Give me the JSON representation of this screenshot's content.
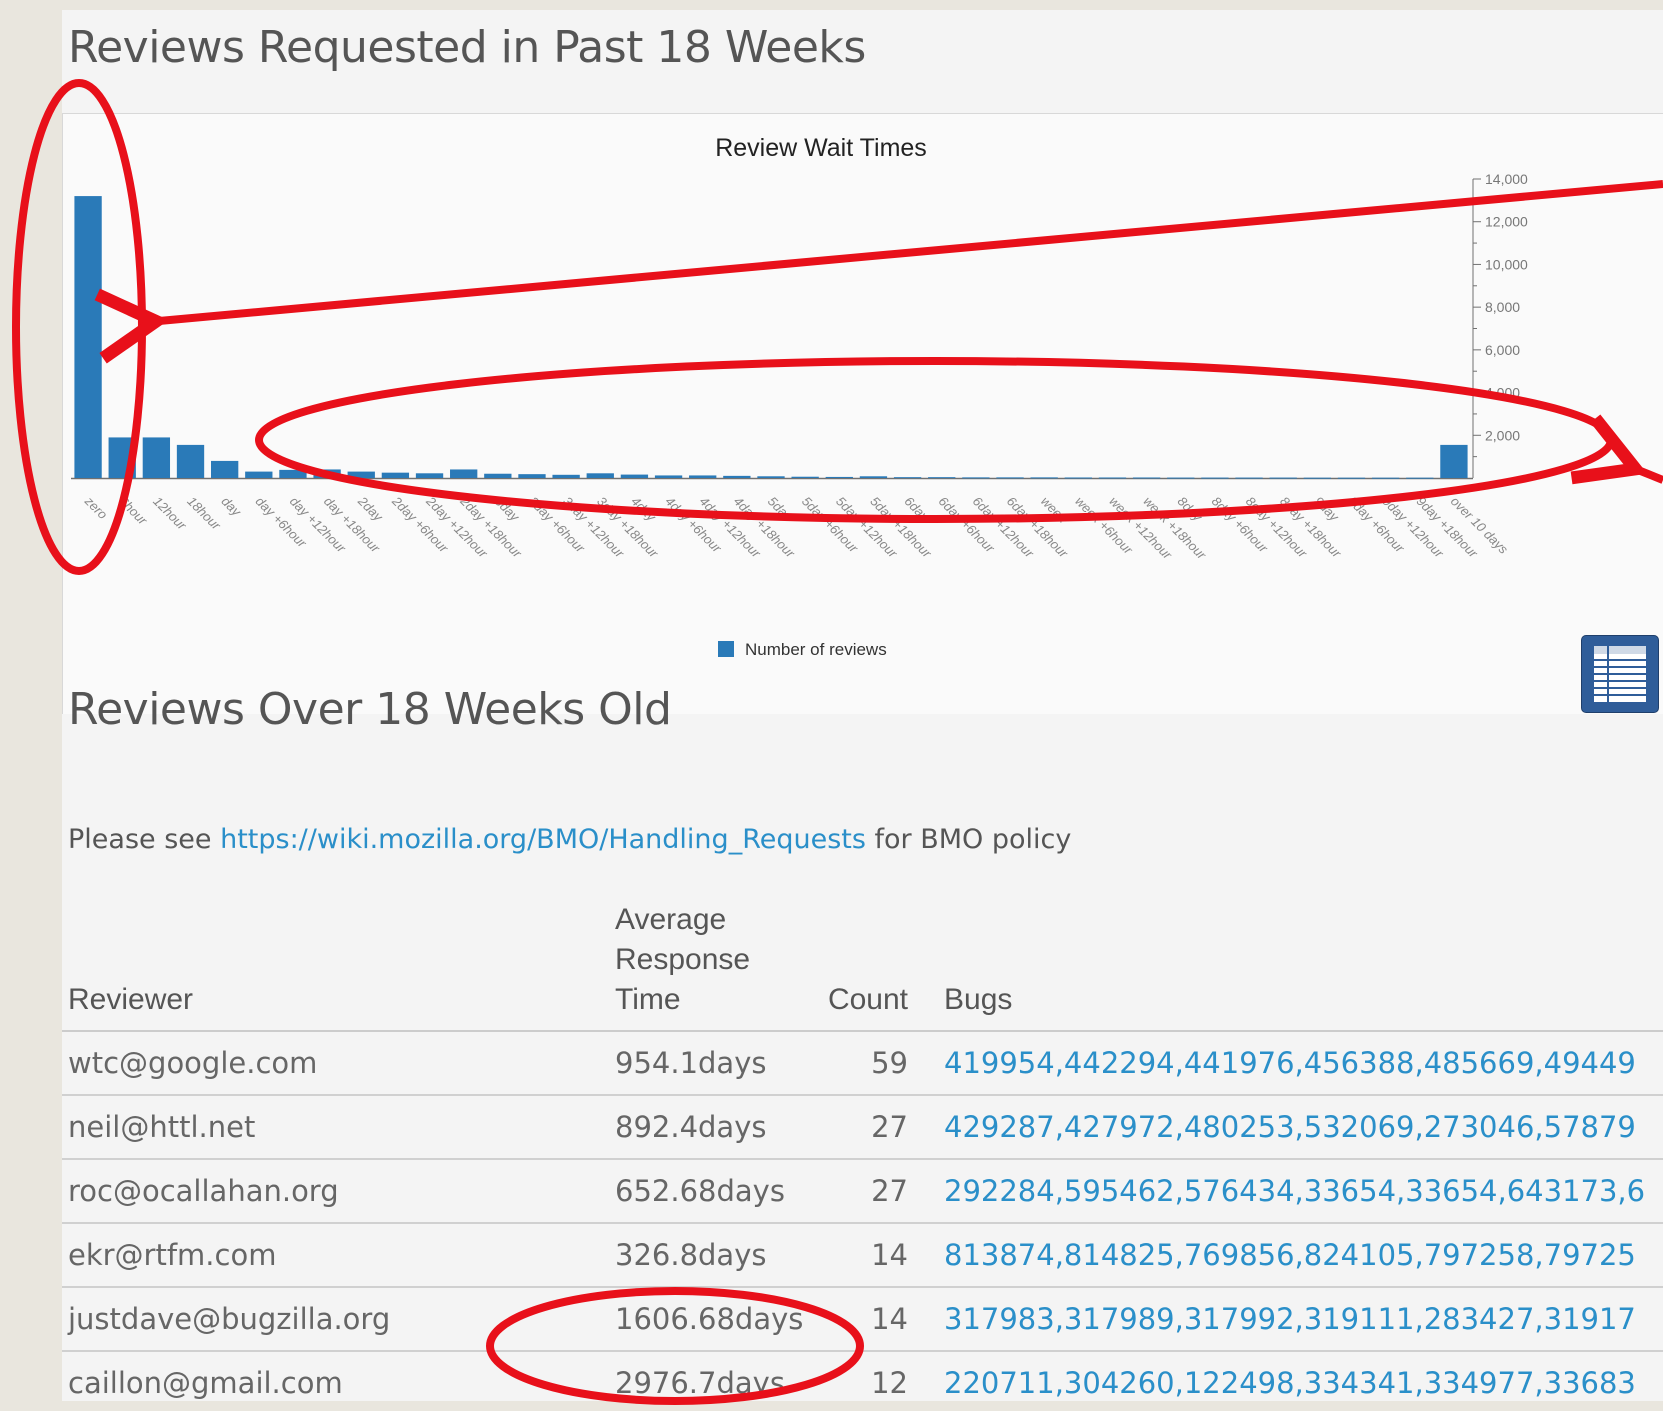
{
  "header": {
    "title": "Reviews Requested in Past 18 Weeks"
  },
  "chart_data": {
    "type": "bar",
    "title": "Review Wait Times",
    "xlabel": "",
    "ylabel": "",
    "ylim": [
      0,
      14000
    ],
    "yticks": [
      "14,000",
      "12,000",
      "10,000",
      "8,000",
      "6,000",
      "4,000",
      "2,000"
    ],
    "legend_position": "bottom-center",
    "grid": false,
    "bar_color": "#2a7ab8",
    "categories": [
      "zero",
      "6hour",
      "12hour",
      "18hour",
      "day",
      "day +6hour",
      "day +12hour",
      "day +18hour",
      "2day",
      "2day +6hour",
      "2day +12hour",
      "2day +18hour",
      "3day",
      "3day +6hour",
      "3day +12hour",
      "3day +18hour",
      "4day",
      "4day +6hour",
      "4day +12hour",
      "4day +18hour",
      "5day",
      "5day +6hour",
      "5day +12hour",
      "5day +18hour",
      "6day",
      "6day +6hour",
      "6day +12hour",
      "6day +18hour",
      "week",
      "week +6hour",
      "week +12hour",
      "week +18hour",
      "8day",
      "8day +6hour",
      "8day +12hour",
      "8day +18hour",
      "9day",
      "9day +6hour",
      "9day +12hour",
      "9day +18hour",
      "over 10 days"
    ],
    "series": [
      {
        "name": "Number of reviews",
        "values": [
          13200,
          1900,
          1900,
          1550,
          800,
          300,
          380,
          400,
          300,
          250,
          220,
          400,
          200,
          180,
          150,
          220,
          160,
          120,
          120,
          100,
          80,
          60,
          50,
          80,
          40,
          40,
          30,
          30,
          30,
          25,
          25,
          25,
          20,
          20,
          20,
          20,
          15,
          15,
          15,
          15,
          1550
        ]
      }
    ]
  },
  "section2": {
    "title": "Reviews Over 18 Weeks Old",
    "policy_prefix": "Please see ",
    "policy_link": "https://wiki.mozilla.org/BMO/Handling_Requests",
    "policy_suffix": " for BMO policy"
  },
  "table": {
    "headers": [
      "Reviewer",
      "Average Response Time",
      "Count",
      "Bugs"
    ],
    "rows": [
      [
        "wtc@google.com",
        "954.1days",
        "59",
        "419954,442294,441976,456388,485669,49449"
      ],
      [
        "neil@httl.net",
        "892.4days",
        "27",
        "429287,427972,480253,532069,273046,57879"
      ],
      [
        "roc@ocallahan.org",
        "652.68days",
        "27",
        "292284,595462,576434,33654,33654,643173,6"
      ],
      [
        "ekr@rtfm.com",
        "326.8days",
        "14",
        "813874,814825,769856,824105,797258,79725"
      ],
      [
        "justdave@bugzilla.org",
        "1606.68days",
        "14",
        "317983,317989,317992,319111,283427,31917"
      ],
      [
        "caillon@gmail.com",
        "2976.7days",
        "12",
        "220711,304260,122498,334341,334977,33683"
      ]
    ]
  },
  "colors": {
    "annotation": "#e8101a",
    "link": "#2a8fc9"
  }
}
